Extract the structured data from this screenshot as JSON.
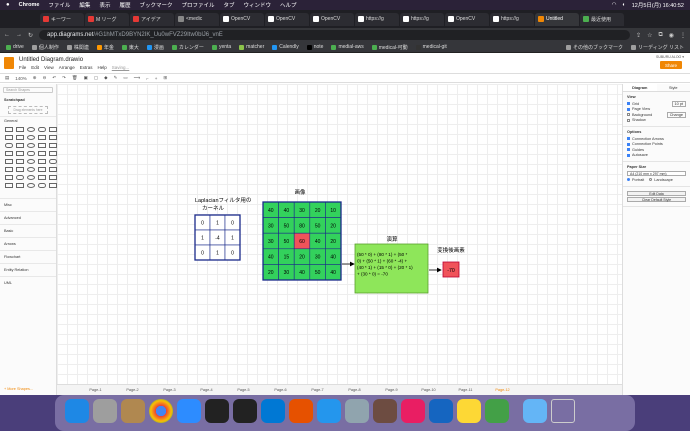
{
  "menubar": {
    "app": "Chrome",
    "items": [
      "ファイル",
      "編集",
      "表示",
      "履歴",
      "ブックマーク",
      "プロファイル",
      "タブ",
      "ウィンドウ",
      "ヘルプ"
    ],
    "clock": "12月5日(月) 16:40:52"
  },
  "tabs": [
    {
      "label": "キーワー",
      "color": "#e53935"
    },
    {
      "label": "M リーグ",
      "color": "#e53935"
    },
    {
      "label": "アイデア",
      "color": "#e53935"
    },
    {
      "label": "<medic",
      "color": "#888"
    },
    {
      "label": "OpenCV",
      "color": "#fff"
    },
    {
      "label": "OpenCV",
      "color": "#fff"
    },
    {
      "label": "OpenCV",
      "color": "#fff"
    },
    {
      "label": "https://g",
      "color": "#fff"
    },
    {
      "label": "https://g",
      "color": "#fff"
    },
    {
      "label": "OpenCV",
      "color": "#fff"
    },
    {
      "label": "https://g",
      "color": "#fff"
    },
    {
      "label": "Untitled",
      "color": "#f08705"
    },
    {
      "label": "最近使用",
      "color": "#4caf50"
    }
  ],
  "address": {
    "host": "app.diagrams.net",
    "path": "/#G1hMTxD9BYN2IK_Uu0wFVZ29Itw0blJ6_vnE"
  },
  "bookmarks": [
    "drive",
    "個人制作",
    "株関連",
    "年金",
    "東大",
    "漫画",
    "カレンダー",
    "yenta",
    "matcher",
    "Calendly",
    "note",
    "medial-aws",
    "medical-可動",
    "medical-git",
    "その他のブックマーク",
    "リーディング リスト"
  ],
  "doc": {
    "title": "Untitled Diagram.drawio",
    "menus": [
      "File",
      "Edit",
      "View",
      "Arrange",
      "Extras",
      "Help"
    ],
    "saving": "Saving...",
    "share": "Share",
    "user": "SUBURU ALOO ▾"
  },
  "toolbar": {
    "zoom": "140%"
  },
  "left": {
    "search": "Search Shapes",
    "scratchpad": "Scratchpad",
    "drag": "Drag elements here",
    "general": "General",
    "sections": [
      "Misc",
      "Advanced",
      "Basic",
      "Arrows",
      "Flowchart",
      "Entity Relation",
      "UML"
    ],
    "more": "+ More Shapes..."
  },
  "right": {
    "tabs": [
      "Diagram",
      "Style"
    ],
    "view": "View",
    "grid": "Grid",
    "gridsize": "10 pt",
    "pageview": "Page View",
    "background": "Background",
    "shadow": "Shadow",
    "change": "Change",
    "options": "Options",
    "opts": [
      "Connection Arrows",
      "Connection Points",
      "Guides",
      "Autosave"
    ],
    "papersize": "Paper Size",
    "paper": "A4 (210 mm x 297 mm)",
    "portrait": "Portrait",
    "landscape": "Landscape",
    "editdata": "Edit Data",
    "clearstyle": "Clear Default Style"
  },
  "pages": [
    "Page-1",
    "Page-2",
    "Page-3",
    "Page-4",
    "Page-5",
    "Page-6",
    "Page-7",
    "Page-8",
    "Page-9",
    "Page-10",
    "Page-11",
    "Page-12"
  ],
  "diagram": {
    "kernel_title": "Laplacianフィルタ用の\nカーネル",
    "kernel": [
      [
        "0",
        "1",
        "0"
      ],
      [
        "1",
        "-4",
        "1"
      ],
      [
        "0",
        "1",
        "0"
      ]
    ],
    "image_title": "画像",
    "image": [
      [
        "40",
        "40",
        "30",
        "20",
        "10"
      ],
      [
        "30",
        "50",
        "80",
        "50",
        "20"
      ],
      [
        "30",
        "50",
        "60",
        "40",
        "20"
      ],
      [
        "40",
        "15",
        "20",
        "30",
        "40"
      ],
      [
        "20",
        "30",
        "40",
        "50",
        "40"
      ]
    ],
    "calc_title": "演算",
    "calc_text": "(50 * 0) + (80 * 1) + (50 * 0) + (50 * 1) + (60 * -4) + (40 * 1) + (15 * 0) + (20 * 1) + (30 * 0) = -70",
    "result_title": "変換後画素",
    "result": "-70"
  }
}
